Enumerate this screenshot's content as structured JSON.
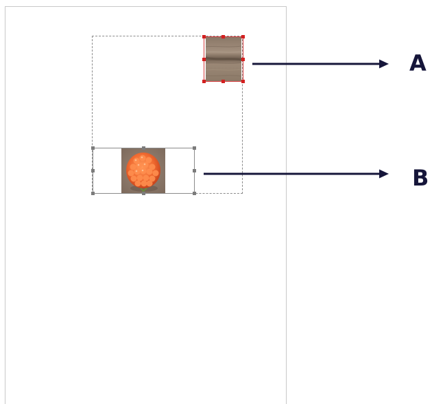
{
  "callouts": {
    "a_label": "A",
    "b_label": "B"
  },
  "images": {
    "a": {
      "subject": "wood-texture-image",
      "selected": true,
      "selection_color": "#d33a3a"
    },
    "b": {
      "subject": "raspberry-image",
      "selected": false,
      "selection_color": "#7c7c7c"
    }
  },
  "colors": {
    "arrow": "#16163a",
    "page_border": "#c8c8c8",
    "group_frame": "#8a8a8a"
  }
}
